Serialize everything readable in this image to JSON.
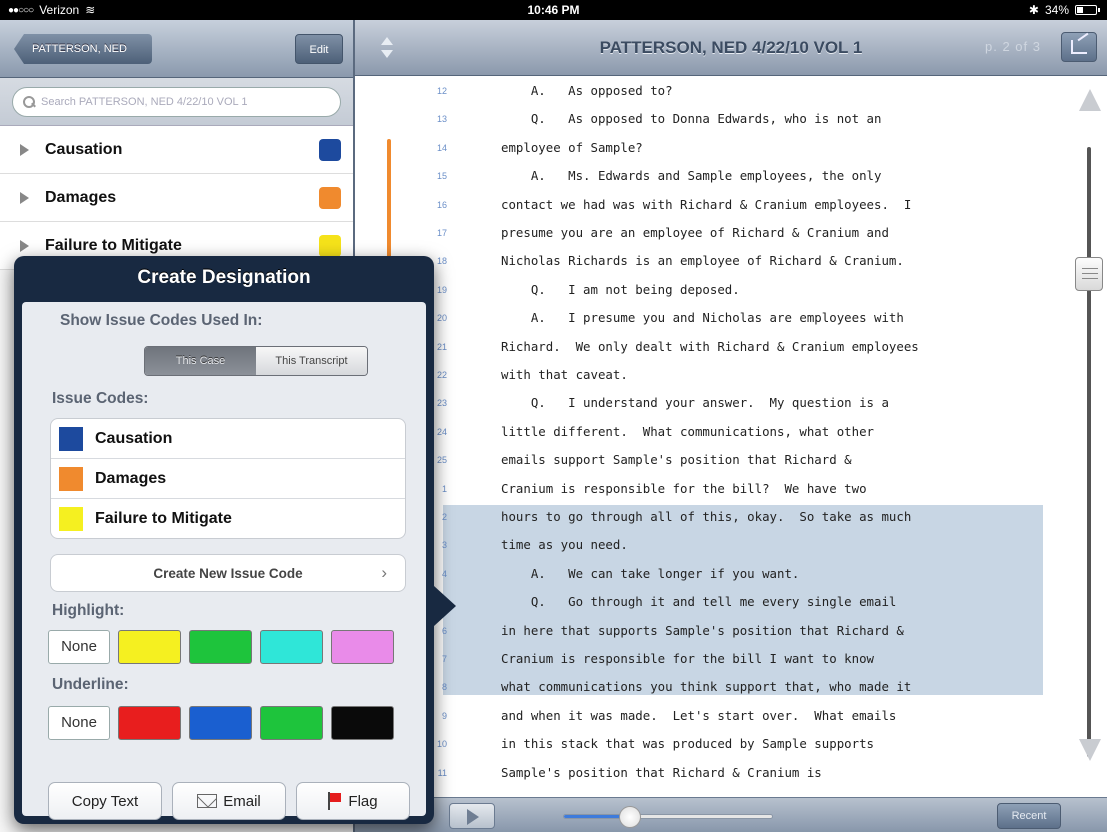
{
  "status_bar": {
    "carrier": "Verizon",
    "time": "10:46 PM",
    "battery": "34%"
  },
  "left_pane": {
    "back_label": "PATTERSON, NED",
    "edit_label": "Edit",
    "search_placeholder": "Search PATTERSON, NED 4/22/10 VOL 1",
    "issues": [
      {
        "label": "Causation",
        "color": "#1d4a9e"
      },
      {
        "label": "Damages",
        "color": "#f08a2e"
      },
      {
        "label": "Failure to Mitigate",
        "color": "#f5e21a"
      }
    ]
  },
  "right_pane": {
    "title": "PATTERSON, NED 4/22/10 VOL 1",
    "page_counter": "p. 2 of 3",
    "recent_label": "Recent",
    "media_progress": 0.28,
    "transcript": [
      {
        "n": "12",
        "text": "    A.   As opposed to?"
      },
      {
        "n": "13",
        "text": "    Q.   As opposed to Donna Edwards, who is not an"
      },
      {
        "n": "14",
        "text": "employee of Sample?"
      },
      {
        "n": "15",
        "text": "    A.   Ms. Edwards and Sample employees, the only"
      },
      {
        "n": "16",
        "text": "contact we had was with Richard & Cranium employees.  I"
      },
      {
        "n": "17",
        "text": "presume you are an employee of Richard & Cranium and"
      },
      {
        "n": "18",
        "text": "Nicholas Richards is an employee of Richard & Cranium."
      },
      {
        "n": "19",
        "text": "    Q.   I am not being deposed."
      },
      {
        "n": "20",
        "text": "    A.   I presume you and Nicholas are employees with"
      },
      {
        "n": "21",
        "text": "Richard.  We only dealt with Richard & Cranium employees"
      },
      {
        "n": "22",
        "text": "with that caveat."
      },
      {
        "n": "23",
        "text": "    Q.   I understand your answer.  My question is a"
      },
      {
        "n": "24",
        "text": "little different.  What communications, what other"
      },
      {
        "n": "25",
        "text": "emails support Sample's position that Richard &"
      },
      {
        "n": "1",
        "text": "Cranium is responsible for the bill?  We have two"
      },
      {
        "n": "2",
        "text": "hours to go through all of this, okay.  So take as much"
      },
      {
        "n": "3",
        "text": "time as you need."
      },
      {
        "n": "4",
        "text": "    A.   We can take longer if you want."
      },
      {
        "n": "5",
        "text": "    Q.   Go through it and tell me every single email"
      },
      {
        "n": "6",
        "text": "in here that supports Sample's position that Richard &"
      },
      {
        "n": "7",
        "text": "Cranium is responsible for the bill I want to know"
      },
      {
        "n": "8",
        "text": "what communications you think support that, who made it"
      },
      {
        "n": "9",
        "text": "and when it was made.  Let's start over.  What emails"
      },
      {
        "n": "10",
        "text": "in this stack that was produced by Sample supports"
      },
      {
        "n": "11",
        "text": "Sample's position that Richard & Cranium is"
      }
    ]
  },
  "popover": {
    "title": "Create Designation",
    "show_label": "Show Issue Codes Used In:",
    "seg_case": "This Case",
    "seg_transcript": "This Transcript",
    "issue_codes_label": "Issue Codes:",
    "codes": [
      {
        "label": "Causation",
        "color": "#1d4a9e"
      },
      {
        "label": "Damages",
        "color": "#f08a2e"
      },
      {
        "label": "Failure to Mitigate",
        "color": "#f5f020"
      }
    ],
    "create_new": "Create New Issue Code",
    "highlight_label": "Highlight:",
    "underline_label": "Underline:",
    "none_label": "None",
    "highlight_colors": [
      "#f5f020",
      "#1ec43c",
      "#2fe6d8",
      "#e98be9"
    ],
    "underline_colors": [
      "#e81e1e",
      "#1a5fd0",
      "#1ec43c",
      "#0a0a0a"
    ],
    "copy_label": "Copy Text",
    "email_label": "Email",
    "flag_label": "Flag"
  }
}
